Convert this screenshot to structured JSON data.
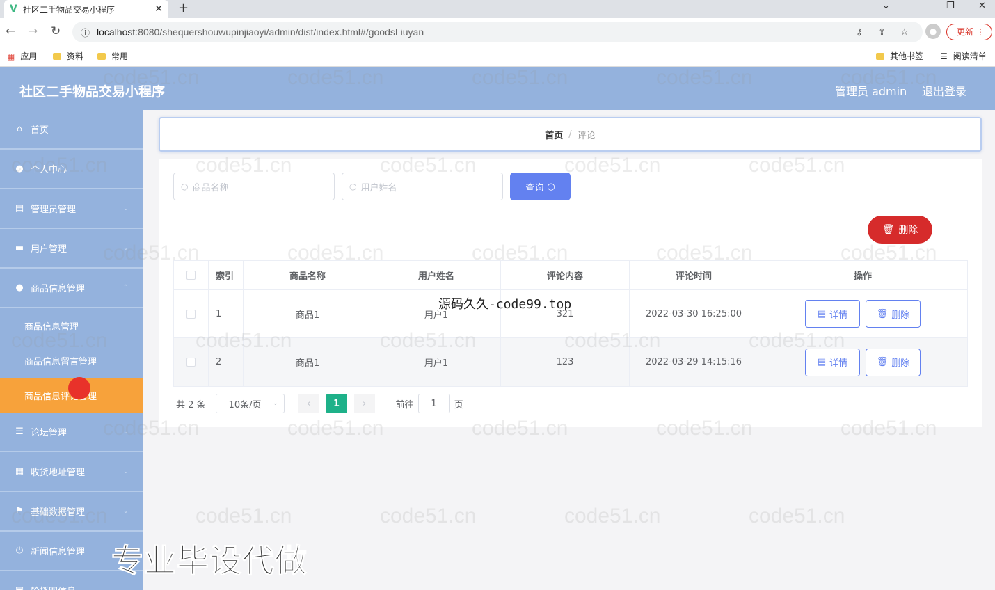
{
  "browser": {
    "tab_title": "社区二手物品交易小程序",
    "url_host": "localhost",
    "url_rest": ":8080/shequershouwupinjiaoyi/admin/dist/index.html#/goodsLiuyan",
    "update_label": "更新",
    "bookmarks": {
      "apps": "应用",
      "b1": "资料",
      "b2": "常用",
      "other": "其他书签",
      "reading": "阅读清单"
    }
  },
  "header": {
    "title": "社区二手物品交易小程序",
    "user": "管理员 admin",
    "logout": "退出登录"
  },
  "sidebar": {
    "items": [
      {
        "label": "首页"
      },
      {
        "label": "个人中心"
      },
      {
        "label": "管理员管理"
      },
      {
        "label": "用户管理"
      },
      {
        "label": "商品信息管理"
      }
    ],
    "sub_items": [
      {
        "label": "商品信息管理"
      },
      {
        "label": "商品信息留言管理"
      },
      {
        "label": "商品信息评论管理"
      }
    ],
    "items_after": [
      {
        "label": "论坛管理"
      },
      {
        "label": "收货地址管理"
      },
      {
        "label": "基础数据管理"
      },
      {
        "label": "新闻信息管理"
      },
      {
        "label": "轮播图信息"
      }
    ]
  },
  "breadcrumb": {
    "home": "首页",
    "sep": "/",
    "current": "评论"
  },
  "search": {
    "name_placeholder": "商品名称",
    "user_placeholder": "用户姓名",
    "query_label": "查询"
  },
  "toolbar": {
    "delete_label": "删除"
  },
  "table": {
    "headers": [
      "索引",
      "商品名称",
      "用户姓名",
      "评论内容",
      "评论时间",
      "操作"
    ],
    "rows": [
      {
        "idx": "1",
        "name": "商品1",
        "user": "用户1",
        "content": "321",
        "time": "2022-03-30 16:25:00"
      },
      {
        "idx": "2",
        "name": "商品1",
        "user": "用户1",
        "content": "123",
        "time": "2022-03-29 14:15:16"
      }
    ],
    "detail_label": "详情",
    "delete_label": "删除"
  },
  "pagination": {
    "total": "共 2 条",
    "page_size": "10条/页",
    "current_page": "1",
    "goto_label": "前往",
    "goto_value": "1",
    "page_unit": "页"
  },
  "overlays": {
    "mid": "源码久久-code99.top",
    "big": "专业毕设代做",
    "watermark": "code51.cn"
  }
}
